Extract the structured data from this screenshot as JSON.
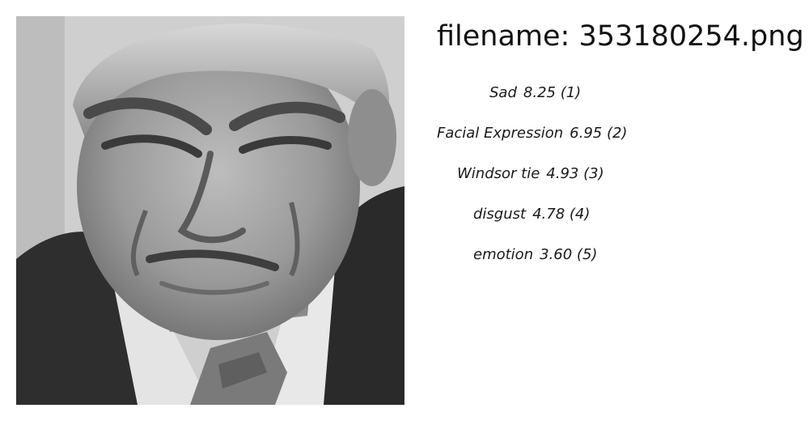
{
  "header": {
    "filename_prefix": "filename:",
    "filename": "353180254.png"
  },
  "image": {
    "icon": "face-photo",
    "description_colors": {
      "background": "#c9c9c9",
      "suit": "#2f2f2f",
      "shirt": "#e6e6e6",
      "tie": "#7a7a7a"
    }
  },
  "predictions": [
    {
      "label": "Sad",
      "score": "8.25",
      "rank": "(1)"
    },
    {
      "label": "Facial Expression",
      "score": "6.95",
      "rank": "(2)"
    },
    {
      "label": "Windsor tie",
      "score": "4.93",
      "rank": "(3)"
    },
    {
      "label": "disgust",
      "score": "4.78",
      "rank": "(4)"
    },
    {
      "label": "emotion",
      "score": "3.60",
      "rank": "(5)"
    }
  ]
}
